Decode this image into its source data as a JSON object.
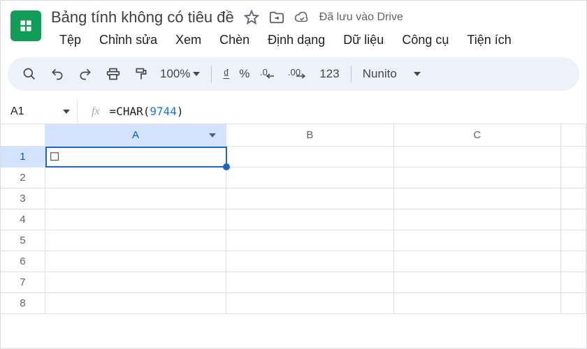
{
  "app": {
    "title": "Bảng tính không có tiêu đề",
    "saved_status": "Đã lưu vào Drive"
  },
  "menubar": {
    "items": [
      "Tệp",
      "Chỉnh sửa",
      "Xem",
      "Chèn",
      "Định dạng",
      "Dữ liệu",
      "Công cụ",
      "Tiện ích"
    ]
  },
  "toolbar": {
    "zoom": "100%",
    "currency_symbol": "₫",
    "percent": "%",
    "dec_dec": ".0",
    "inc_dec": ".00",
    "number_format": "123",
    "font": "Nunito"
  },
  "formula_bar": {
    "name_box": "A1",
    "fx_label": "fx",
    "formula_prefix": "=CHAR",
    "formula_open": "(",
    "formula_arg": "9744",
    "formula_close": ")"
  },
  "grid": {
    "columns": [
      "A",
      "B",
      "C"
    ],
    "selected_column": "A",
    "rows": [
      1,
      2,
      3,
      4,
      5,
      6,
      7,
      8
    ],
    "selected_row": 1,
    "cells": {
      "A1": "☐"
    }
  }
}
